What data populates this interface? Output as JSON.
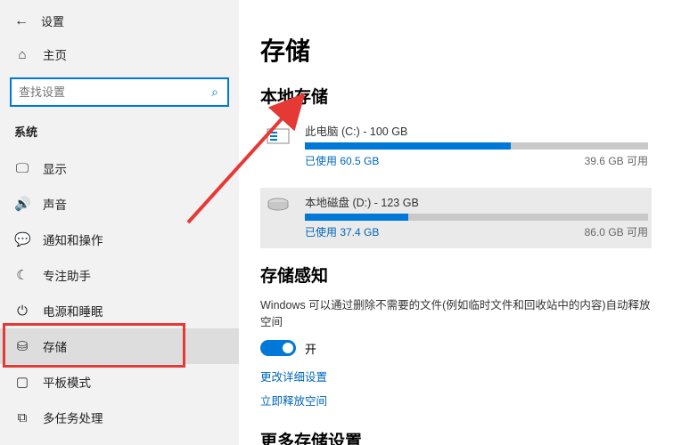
{
  "header": {
    "title": "设置"
  },
  "home": {
    "label": "主页"
  },
  "search": {
    "placeholder": "查找设置"
  },
  "category": {
    "title": "系统"
  },
  "nav": {
    "display": "显示",
    "sound": "声音",
    "notifications": "通知和操作",
    "focus": "专注助手",
    "power": "电源和睡眠",
    "storage": "存储",
    "tablet": "平板模式",
    "multitask": "多任务处理"
  },
  "page": {
    "title": "存储",
    "local_title": "本地存储",
    "drive_c": {
      "title": "此电脑 (C:) - 100 GB",
      "used": "已使用 60.5 GB",
      "free": "39.6 GB 可用"
    },
    "drive_d": {
      "title": "本地磁盘 (D:) - 123 GB",
      "used": "已使用 37.4 GB",
      "free": "86.0 GB 可用"
    },
    "sense_title": "存储感知",
    "sense_desc": "Windows 可以通过删除不需要的文件(例如临时文件和回收站中的内容)自动释放空间",
    "toggle_label": "开",
    "link_detail": "更改详细设置",
    "link_free": "立即释放空间",
    "more_title": "更多存储设置"
  }
}
